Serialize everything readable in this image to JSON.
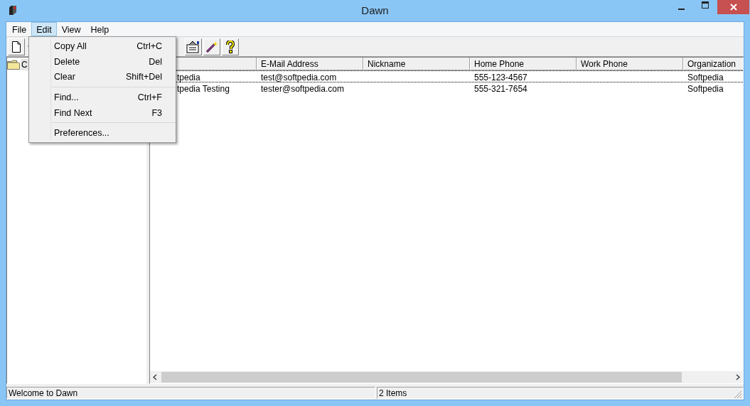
{
  "window": {
    "title": "Dawn"
  },
  "menu_bar": [
    {
      "label": "File",
      "selected": false
    },
    {
      "label": "Edit",
      "selected": true
    },
    {
      "label": "View",
      "selected": false
    },
    {
      "label": "Help",
      "selected": false
    }
  ],
  "edit_menu": [
    {
      "kind": "item",
      "label": "Copy All",
      "shortcut": "Ctrl+C"
    },
    {
      "kind": "item",
      "label": "Delete",
      "shortcut": "Del"
    },
    {
      "kind": "item",
      "label": "Clear",
      "shortcut": "Shift+Del"
    },
    {
      "kind": "separator"
    },
    {
      "kind": "item",
      "label": "Find...",
      "shortcut": "Ctrl+F"
    },
    {
      "kind": "item",
      "label": "Find Next",
      "shortcut": "F3"
    },
    {
      "kind": "separator"
    },
    {
      "kind": "item",
      "label": "Preferences..."
    }
  ],
  "tree": {
    "items": [
      {
        "label": "C",
        "selected": true
      }
    ]
  },
  "table": {
    "columns": [
      "",
      "E-Mail Address",
      "Nickname",
      "Home Phone",
      "Work Phone",
      "Organization"
    ],
    "rows": [
      [
        "tpedia",
        "test@softpedia.com",
        "",
        "555-123-4567",
        "",
        "Softpedia"
      ],
      [
        "tpedia Testing",
        "tester@softpedia.com",
        "",
        "555-321-7654",
        "",
        "Softpedia"
      ]
    ]
  },
  "status_bar": [
    "Welcome to Dawn",
    "2 Items"
  ]
}
